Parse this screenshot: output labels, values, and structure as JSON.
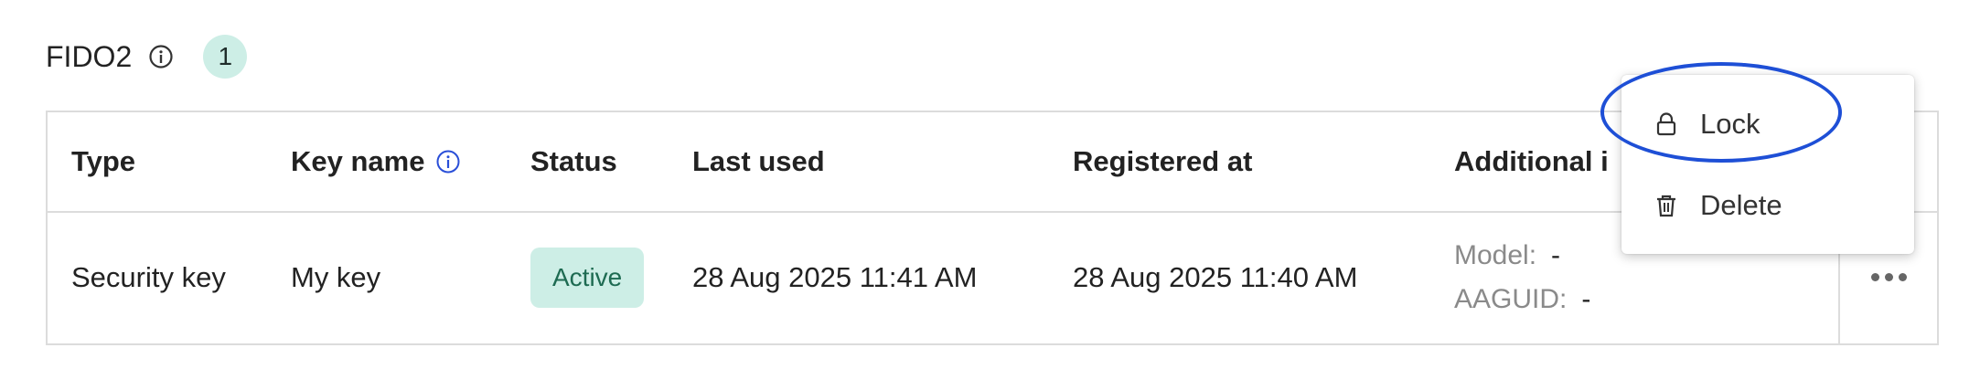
{
  "section": {
    "title": "FIDO2",
    "count": "1"
  },
  "table": {
    "headers": {
      "type": "Type",
      "key_name": "Key name",
      "status": "Status",
      "last_used": "Last used",
      "registered_at": "Registered at",
      "additional": "Additional i"
    },
    "rows": [
      {
        "type": "Security key",
        "key_name": "My key",
        "status": "Active",
        "last_used": "28 Aug 2025 11:41 AM",
        "registered_at": "28 Aug 2025 11:40 AM",
        "model_label": "Model:",
        "model_value": "-",
        "aaguid_label": "AAGUID:",
        "aaguid_value": "-"
      }
    ]
  },
  "menu": {
    "lock_label": "Lock",
    "delete_label": "Delete"
  },
  "colors": {
    "badge_bg": "#cdeee6",
    "status_text": "#1e6b52",
    "info_icon_blue": "#2a4fd8",
    "highlight": "#1e4fd6",
    "border": "#dcdcdc"
  }
}
